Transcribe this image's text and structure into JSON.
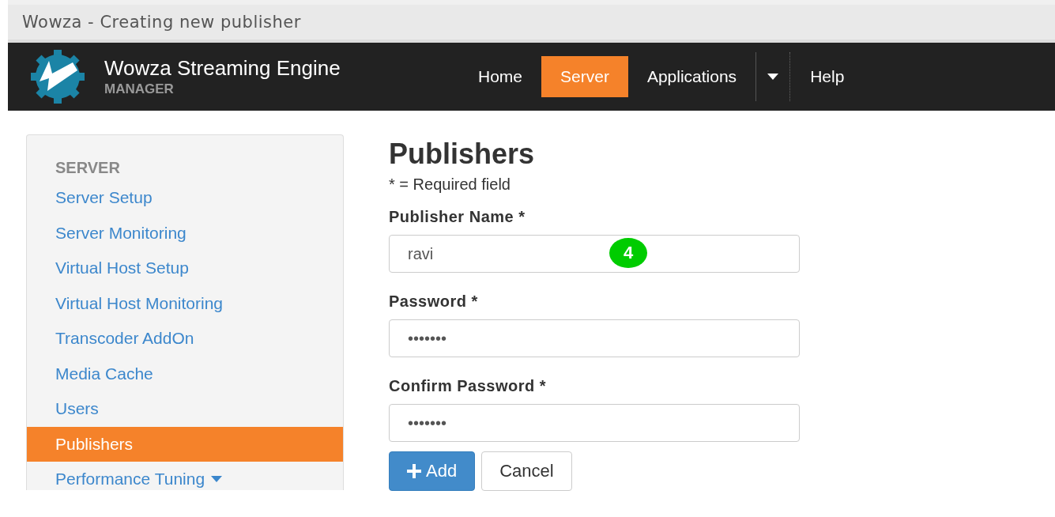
{
  "window": {
    "title": "Wowza - Creating new publisher"
  },
  "brand": {
    "name": "Wowza Streaming Engine",
    "subtitle": "MANAGER"
  },
  "nav": [
    {
      "label": "Home",
      "selected": false,
      "kind": "link"
    },
    {
      "label": "Server",
      "selected": true,
      "kind": "link"
    },
    {
      "label": "Applications",
      "selected": false,
      "kind": "link"
    },
    {
      "kind": "dropdown",
      "selected": false
    },
    {
      "label": "Help",
      "selected": false,
      "kind": "link"
    }
  ],
  "sidebar": {
    "heading": "SERVER",
    "items": [
      {
        "label": "Server Setup",
        "selected": false
      },
      {
        "label": "Server Monitoring",
        "selected": false
      },
      {
        "label": "Virtual Host Setup",
        "selected": false
      },
      {
        "label": "Virtual Host Monitoring",
        "selected": false
      },
      {
        "label": "Transcoder AddOn",
        "selected": false
      },
      {
        "label": "Media Cache",
        "selected": false
      },
      {
        "label": "Users",
        "selected": false
      },
      {
        "label": "Publishers",
        "selected": true
      },
      {
        "label": "Performance Tuning",
        "selected": false,
        "expandable": true
      }
    ]
  },
  "form": {
    "title": "Publishers",
    "note": "* = Required field",
    "fields": [
      {
        "label": "Publisher Name *",
        "value": "ravi",
        "step_badge": "4"
      },
      {
        "label": "Password *",
        "value": "•••••••"
      },
      {
        "label": "Confirm Password *",
        "value": "•••••••"
      }
    ],
    "buttons": [
      {
        "label": "Add",
        "kind": "primary"
      },
      {
        "label": "Cancel",
        "kind": "default"
      }
    ]
  }
}
